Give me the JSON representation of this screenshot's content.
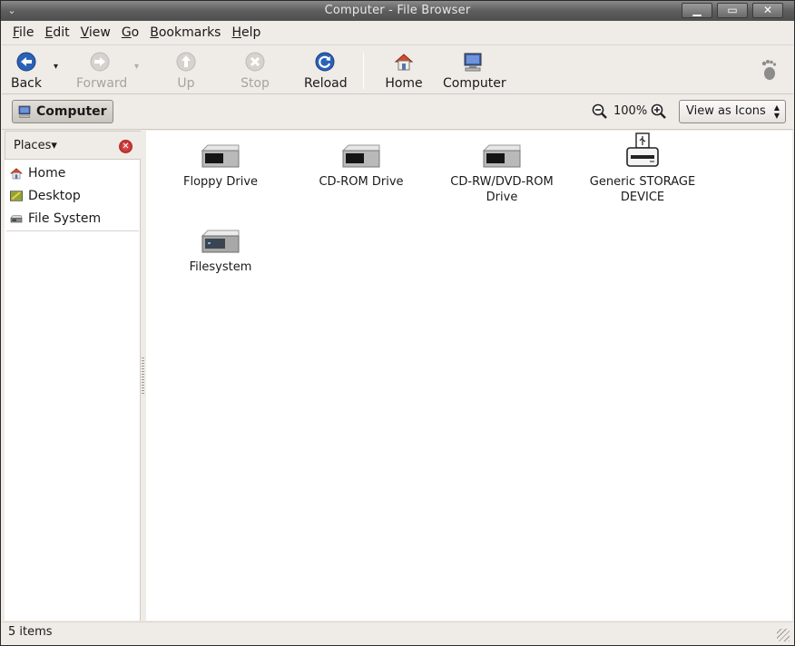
{
  "window": {
    "title": "Computer - File Browser",
    "menu_glyph": "⌄",
    "controls": {
      "minimize": "▁",
      "maximize": "▭",
      "close": "✕"
    }
  },
  "menubar": {
    "items": [
      {
        "label": "File",
        "mnemonic": "F",
        "rest": "ile"
      },
      {
        "label": "Edit",
        "mnemonic": "E",
        "rest": "dit"
      },
      {
        "label": "View",
        "mnemonic": "V",
        "rest": "iew"
      },
      {
        "label": "Go",
        "mnemonic": "G",
        "rest": "o"
      },
      {
        "label": "Bookmarks",
        "mnemonic": "B",
        "rest": "ookmarks"
      },
      {
        "label": "Help",
        "mnemonic": "H",
        "rest": "elp"
      }
    ]
  },
  "toolbar": {
    "back": {
      "label": "Back",
      "icon": "back-arrow-icon",
      "enabled": true
    },
    "forward": {
      "label": "Forward",
      "icon": "forward-arrow-icon",
      "enabled": false
    },
    "up": {
      "label": "Up",
      "icon": "up-arrow-icon",
      "enabled": false
    },
    "stop": {
      "label": "Stop",
      "icon": "stop-icon",
      "enabled": false
    },
    "reload": {
      "label": "Reload",
      "icon": "reload-icon",
      "enabled": true
    },
    "home": {
      "label": "Home",
      "icon": "home-icon",
      "enabled": true
    },
    "computer": {
      "label": "Computer",
      "icon": "computer-icon",
      "enabled": true
    },
    "dropdown_glyph": "▾"
  },
  "location": {
    "path_button": "Computer",
    "zoom_level": "100%",
    "view_mode": "View as Icons"
  },
  "sidebar": {
    "title": "Places",
    "dropdown_glyph": "▾",
    "close_glyph": "✕",
    "items": [
      {
        "label": "Home",
        "icon": "home-icon"
      },
      {
        "label": "Desktop",
        "icon": "desktop-icon"
      },
      {
        "label": "File System",
        "icon": "harddisk-icon"
      }
    ]
  },
  "files": [
    {
      "name": "Floppy Drive",
      "icon": "drive-icon"
    },
    {
      "name": "CD-ROM Drive",
      "icon": "drive-icon"
    },
    {
      "name": "CD-RW/DVD-ROM Drive",
      "icon": "drive-icon"
    },
    {
      "name": "Generic STORAGE DEVICE",
      "icon": "usb-storage-icon"
    },
    {
      "name": "Filesystem",
      "icon": "harddisk-icon"
    }
  ],
  "status": {
    "text": "5 items"
  },
  "colors": {
    "accent_blue": "#2a62b8",
    "window_bg": "#efebe7",
    "titlebar": "#5e5e5e"
  }
}
